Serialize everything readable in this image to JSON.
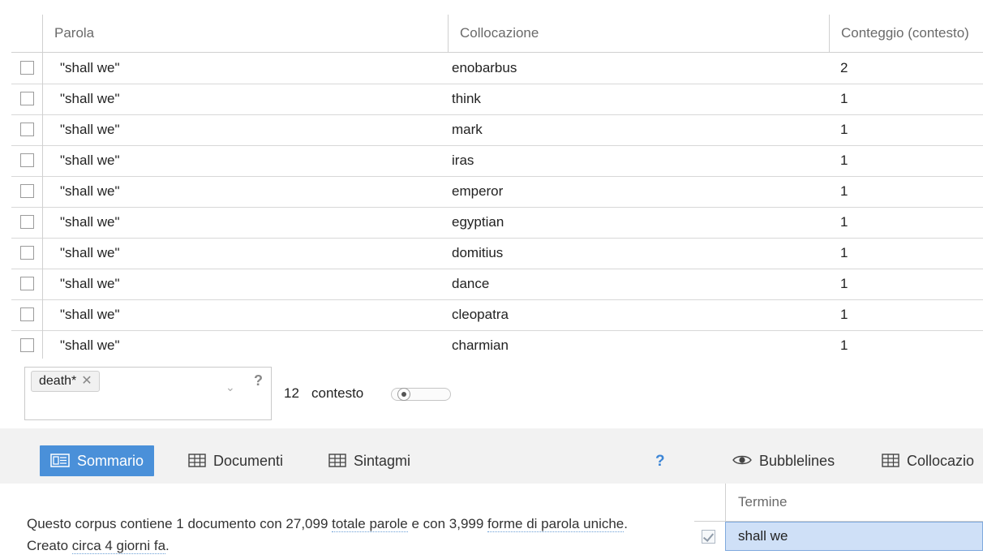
{
  "grid": {
    "columns": [
      "Parola",
      "Collocazione",
      "Conteggio (contesto)"
    ],
    "rows": [
      {
        "word": "\"shall we\"",
        "collocate": "enobarbus",
        "count": "2"
      },
      {
        "word": "\"shall we\"",
        "collocate": "think",
        "count": "1"
      },
      {
        "word": "\"shall we\"",
        "collocate": "mark",
        "count": "1"
      },
      {
        "word": "\"shall we\"",
        "collocate": "iras",
        "count": "1"
      },
      {
        "word": "\"shall we\"",
        "collocate": "emperor",
        "count": "1"
      },
      {
        "word": "\"shall we\"",
        "collocate": "egyptian",
        "count": "1"
      },
      {
        "word": "\"shall we\"",
        "collocate": "domitius",
        "count": "1"
      },
      {
        "word": "\"shall we\"",
        "collocate": "dance",
        "count": "1"
      },
      {
        "word": "\"shall we\"",
        "collocate": "cleopatra",
        "count": "1"
      },
      {
        "word": "\"shall we\"",
        "collocate": "charmian",
        "count": "1"
      }
    ]
  },
  "filter": {
    "tag": "death*",
    "tag_remove": "✕",
    "dropdown_glyph": "⌄",
    "help": "?",
    "context_value": "12",
    "context_label": "contesto",
    "context_slider_level": 0.1
  },
  "toolbar": {
    "tabs": [
      {
        "label": "Sommario",
        "icon": "summary-icon"
      },
      {
        "label": "Documenti",
        "icon": "table-icon"
      },
      {
        "label": "Sintagmi",
        "icon": "table-icon"
      }
    ],
    "help": "?",
    "right_tabs": [
      {
        "label": "Bubblelines",
        "icon": "eye-icon"
      },
      {
        "label": "Collocazio",
        "icon": "table-icon"
      }
    ]
  },
  "summary": {
    "t1": "Questo corpus contiene 1 documento con 27,099 ",
    "l1": "totale parole",
    "t2": " e con 3,999 ",
    "l2": "forme di parola uniche",
    "t3": ". Creato ",
    "l3": "circa 4 giorni fa",
    "t4": "."
  },
  "terms_panel": {
    "header": "Termine",
    "selected_term": "shall we"
  },
  "colors": {
    "active_tab": "#4a90d9",
    "selection": "#cfe0f7",
    "help_blue": "#3d86d6"
  }
}
